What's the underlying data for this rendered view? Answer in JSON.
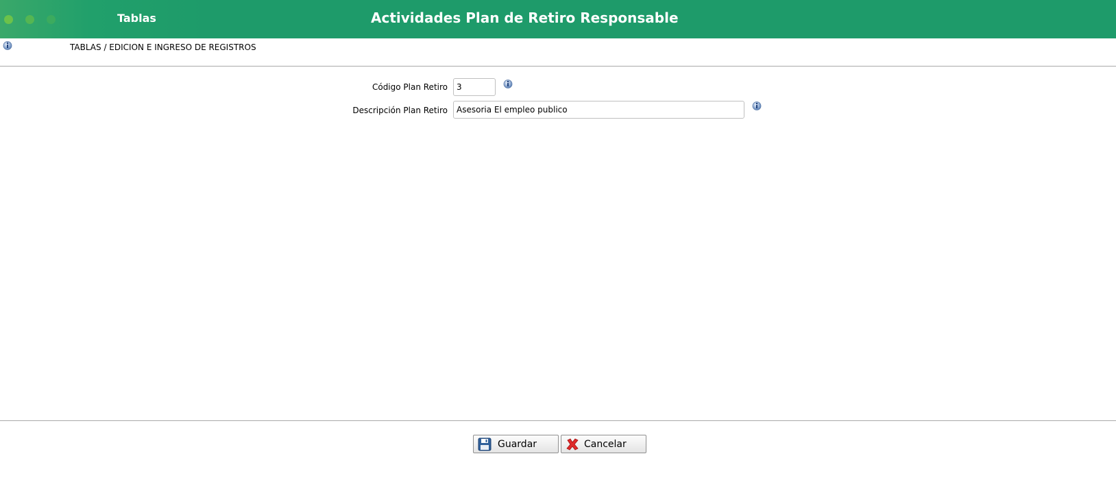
{
  "header": {
    "section": "Tablas",
    "title": "Actividades Plan de Retiro Responsable",
    "colors": {
      "background": "#1e9b6a",
      "text": "#ffffff"
    }
  },
  "breadcrumb": "TABLAS / EDICION E INGRESO DE REGISTROS",
  "form": {
    "codigo": {
      "label": "Código Plan Retiro",
      "value": "3"
    },
    "descripcion": {
      "label": "Descripción Plan Retiro",
      "value": "Asesoria El empleo publico"
    }
  },
  "buttons": {
    "save": {
      "label": "Guardar",
      "icon": "floppy-disk-icon"
    },
    "cancel": {
      "label": "Cancelar",
      "icon": "red-x-icon"
    }
  },
  "icons": {
    "info": "info-icon"
  }
}
